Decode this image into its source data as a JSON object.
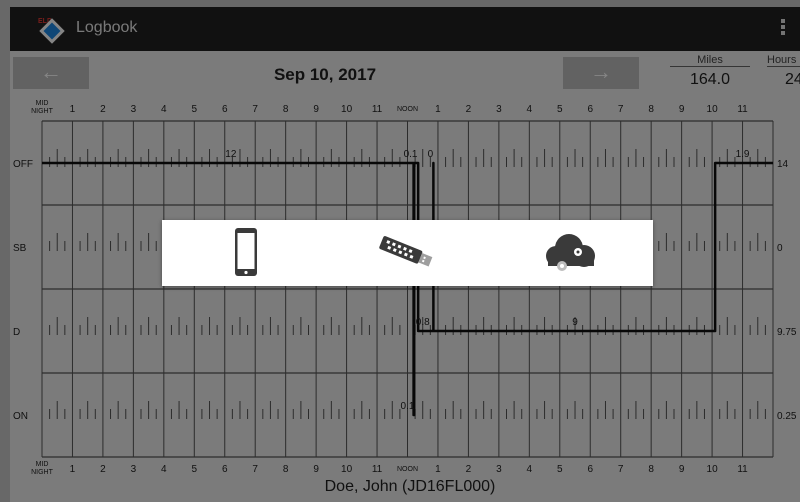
{
  "titlebar": {
    "title": "Logbook",
    "logo_badge": "ELD",
    "menu_icon": "more-vert-icon"
  },
  "date_header": {
    "prev_arrow": "←",
    "next_arrow": "→",
    "date": "Sep 10, 2017",
    "miles_label": "Miles",
    "miles_value": "164.0",
    "hours_label": "Hours",
    "hours_value": "24"
  },
  "grid": {
    "hour_labels_top": [
      "MID NIGHT",
      "1",
      "2",
      "3",
      "4",
      "5",
      "6",
      "7",
      "8",
      "9",
      "10",
      "11",
      "NOON",
      "1",
      "2",
      "3",
      "4",
      "5",
      "6",
      "7",
      "8",
      "9",
      "10",
      "11"
    ],
    "hour_labels_bottom": [
      "MID NIGHT",
      "1",
      "2",
      "3",
      "4",
      "5",
      "6",
      "7",
      "8",
      "9",
      "10",
      "11",
      "NOON",
      "1",
      "2",
      "3",
      "4",
      "5",
      "6",
      "7",
      "8",
      "9",
      "10",
      "11"
    ],
    "rows": [
      {
        "label": "OFF",
        "total": "14"
      },
      {
        "label": "SB",
        "total": "0"
      },
      {
        "label": "D",
        "total": "9.75"
      },
      {
        "label": "ON",
        "total": "0.25"
      }
    ],
    "duration_labels": [
      {
        "text": "12",
        "hour": 6.2,
        "row": 0
      },
      {
        "text": "0.1",
        "hour": 12.1,
        "row": 0
      },
      {
        "text": "0",
        "hour": 12.75,
        "row": 0
      },
      {
        "text": "1.9",
        "hour": 23.0,
        "row": 0
      },
      {
        "text": "0.8",
        "hour": 12.5,
        "row": 2
      },
      {
        "text": "9",
        "hour": 17.5,
        "row": 2
      },
      {
        "text": "0.1",
        "hour": 12.0,
        "row": 3
      }
    ],
    "status_path": [
      [
        0,
        0
      ],
      [
        12.2,
        0
      ],
      [
        12.2,
        3
      ],
      [
        12.22,
        3
      ],
      [
        12.22,
        0
      ],
      [
        12.35,
        0
      ],
      [
        12.35,
        2
      ],
      [
        12.85,
        2
      ],
      [
        12.85,
        0
      ],
      [
        12.85,
        2
      ],
      [
        22.1,
        2
      ],
      [
        22.1,
        0
      ],
      [
        24,
        0
      ]
    ]
  },
  "chooser": {
    "options": [
      {
        "name": "device",
        "icon": "smartphone-icon"
      },
      {
        "name": "usb",
        "icon": "usb-drive-icon"
      },
      {
        "name": "cloud",
        "icon": "cloud-settings-icon"
      }
    ]
  },
  "footer": {
    "driver": "Doe, John (JD16FL000)"
  },
  "colors": {
    "titlebar": "#222222",
    "background": "#ececec",
    "grid_line": "#222222",
    "overlay": "rgba(0,0,0,0.48)",
    "logo_blue": "#1e88e5"
  }
}
